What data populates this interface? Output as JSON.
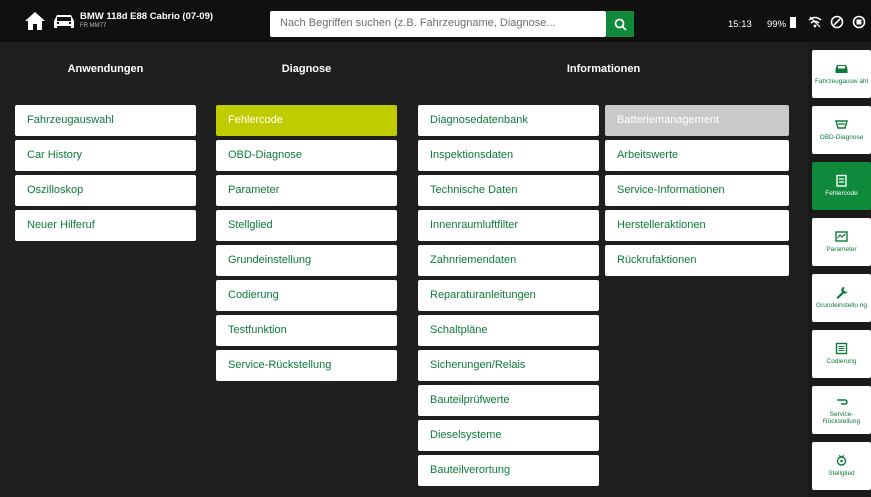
{
  "header": {
    "vehicle_title": "BMW 118d E88 Cabrio (07-09)",
    "vehicle_sub": "FR MM77",
    "search_placeholder": "Nach Begriffen suchen (z.B. Fahrzeugname, Diagnose...",
    "time": "15:13",
    "battery": "99%"
  },
  "columns": {
    "anwendungen": {
      "title": "Anwendungen",
      "items": [
        "Fahrzeugauswahl",
        "Car History",
        "Oszilloskop",
        "Neuer Hilferuf"
      ]
    },
    "diagnose": {
      "title": "Diagnose",
      "items": [
        "Fehlercode",
        "OBD-Diagnose",
        "Parameter",
        "Stellglied",
        "Grundeinstellung",
        "Codierung",
        "Testfunktion",
        "Service-Rückstellung"
      ],
      "active_item": "Fehlercode"
    },
    "informationen": {
      "title": "Informationen",
      "items_left": [
        "Diagnosedatenbank",
        "Inspektionsdaten",
        "Technische Daten",
        "Innenraumluftfilter",
        "Zahnriemendaten",
        "Reparaturanleitungen",
        "Schaltpläne",
        "Sicherungen/Relais",
        "Bauteilprüfwerte",
        "Dieselsysteme",
        "Bauteilverortung"
      ],
      "items_right": [
        "Batteriemanagement",
        "Arbeitswerte",
        "Service-Informationen",
        "Herstelleraktionen",
        "Rückrufaktionen"
      ],
      "disabled_item": "Batteriemanagement"
    }
  },
  "sidebar": {
    "items": [
      {
        "label": "Fahrzeugausw ahl",
        "icon": "car-icon"
      },
      {
        "label": "OBD-Diagnose",
        "icon": "obd-icon"
      },
      {
        "label": "Fehlercode",
        "icon": "fault-code-icon",
        "active": true
      },
      {
        "label": "Parameter",
        "icon": "parameter-icon"
      },
      {
        "label": "Grundeinstellu ng",
        "icon": "wrench-icon"
      },
      {
        "label": "Codierung",
        "icon": "coding-icon"
      },
      {
        "label": "Service-Rückstellung",
        "icon": "service-reset-icon"
      },
      {
        "label": "Stellglied",
        "icon": "actuator-icon"
      }
    ]
  },
  "colors": {
    "accent_green": "#0e8a3a",
    "active_lime": "#bfcd00",
    "text_green": "#0c7a3a",
    "background": "#1f1f1f",
    "topbar": "#101010"
  }
}
